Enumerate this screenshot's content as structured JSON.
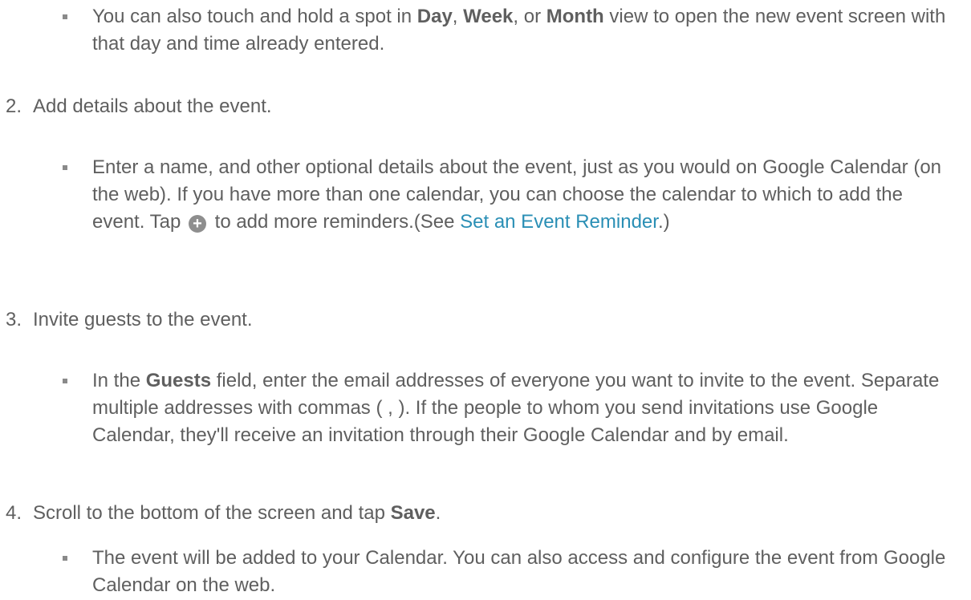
{
  "items": {
    "b0": {
      "t1": "You can also touch and hold a spot in ",
      "day": "Day",
      "t2": ", ",
      "week": "Week",
      "t3": ", or ",
      "month": "Month",
      "t4": " view to open the new event screen with that day and time already entered."
    },
    "s2": {
      "num": "2.",
      "text": "Add details about the event."
    },
    "b2": {
      "t1": "Enter a name, and other optional details about the event, just as you would on Google Calendar (on the web). If you have more than one calendar, you can choose the calendar to which to add the event. Tap ",
      "t2": " to add more reminders.(See ",
      "link": "Set an Event Reminder",
      "t3": ".)"
    },
    "s3": {
      "num": "3.",
      "text": "Invite guests to the event."
    },
    "b3": {
      "t1": "In the ",
      "guests": "Guests",
      "t2": " field, enter the email addresses of everyone you want to invite to the event. Separate multiple addresses with commas ( , ). If the people to whom you send invitations use Google Calendar, they'll receive an invitation through their Google Calendar and by email."
    },
    "s4": {
      "num": "4.",
      "t1": "Scroll to the bottom of the screen and tap ",
      "save": "Save",
      "t2": "."
    },
    "b4": {
      "t1": "The event will be added to your Calendar. You can also access and configure the event from Google Calendar on the web."
    }
  },
  "icons": {
    "add_icon": "plus-circle-icon"
  }
}
